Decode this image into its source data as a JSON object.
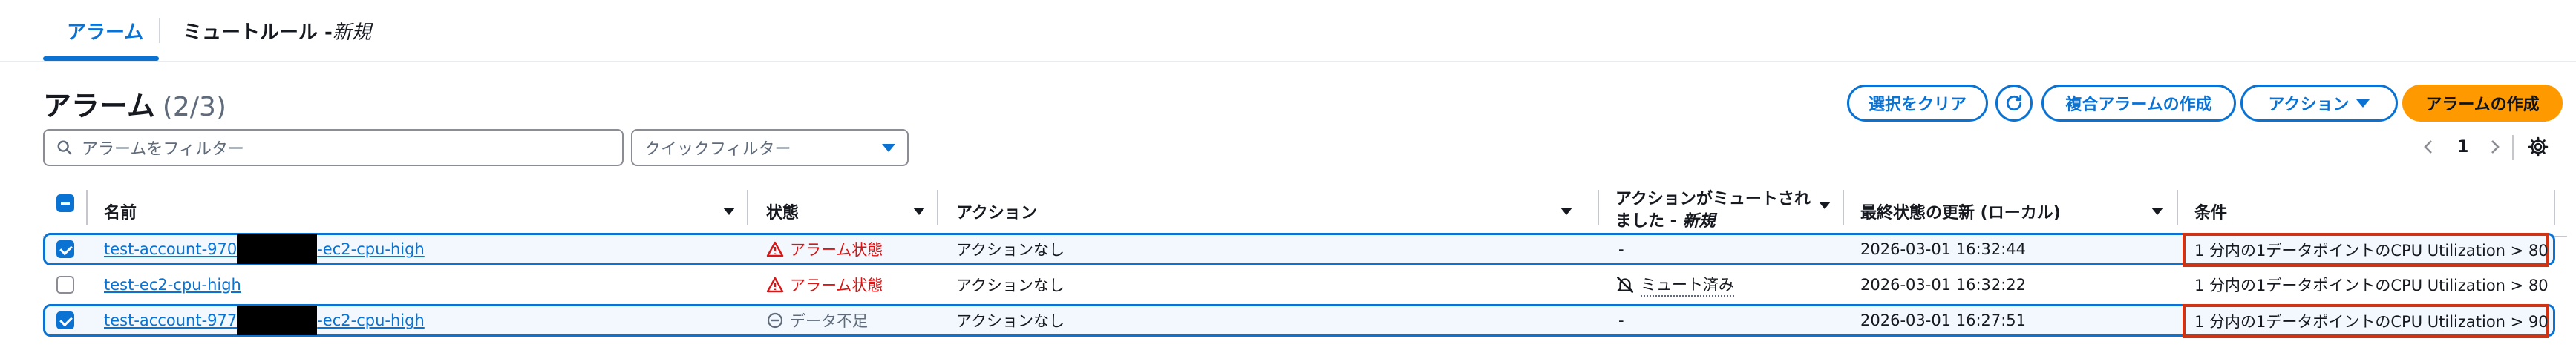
{
  "tabs": [
    {
      "label": "アラーム"
    },
    {
      "label": "ミュートルール - ",
      "badge": "新規"
    }
  ],
  "header": {
    "title": "アラーム",
    "count": "(2/3)"
  },
  "toolbar": {
    "clear_label": "選択をクリア",
    "refresh_icon": "refresh-icon",
    "composite_label": "複合アラームの作成",
    "actions_label": "アクション",
    "create_label": "アラームの作成"
  },
  "filter": {
    "placeholder": "アラームをフィルター",
    "quick_placeholder": "クイックフィルター"
  },
  "pagination": {
    "current_page": "1"
  },
  "table": {
    "columns": [
      {
        "label": "名前"
      },
      {
        "label": "状態"
      },
      {
        "label": "アクション"
      },
      {
        "label_line1": "アクションがミュートされ",
        "label_line2": "ました - ",
        "label_badge": "新規"
      },
      {
        "label": "最終状態の更新 (ローカル)"
      },
      {
        "label": "条件"
      }
    ],
    "rows": [
      {
        "selected": true,
        "name_prefix": "test-account-970",
        "name_suffix": "-ec2-cpu-high",
        "state": "アラーム状態",
        "action": "アクションなし",
        "muted": "-",
        "updated": "2026-03-01 16:32:44",
        "condition": "1 分内の1データポイントのCPU Utilization > 80"
      },
      {
        "selected": false,
        "name": "test-ec2-cpu-high",
        "state": "アラーム状態",
        "action": "アクションなし",
        "muted": "ミュート済み",
        "updated": "2026-03-01 16:32:22",
        "condition": "1 分内の1データポイントのCPU Utilization > 80"
      },
      {
        "selected": true,
        "name_prefix": "test-account-977",
        "name_suffix": "-ec2-cpu-high",
        "state": "データ不足",
        "action": "アクションなし",
        "muted": "-",
        "updated": "2026-03-01 16:27:51",
        "condition": "1 分内の1データポイントのCPU Utilization > 90"
      }
    ]
  },
  "colors": {
    "accent": "#0972d3",
    "primary_button": "#ff9900",
    "alarm": "#d91515",
    "highlight_box": "#d13212"
  }
}
